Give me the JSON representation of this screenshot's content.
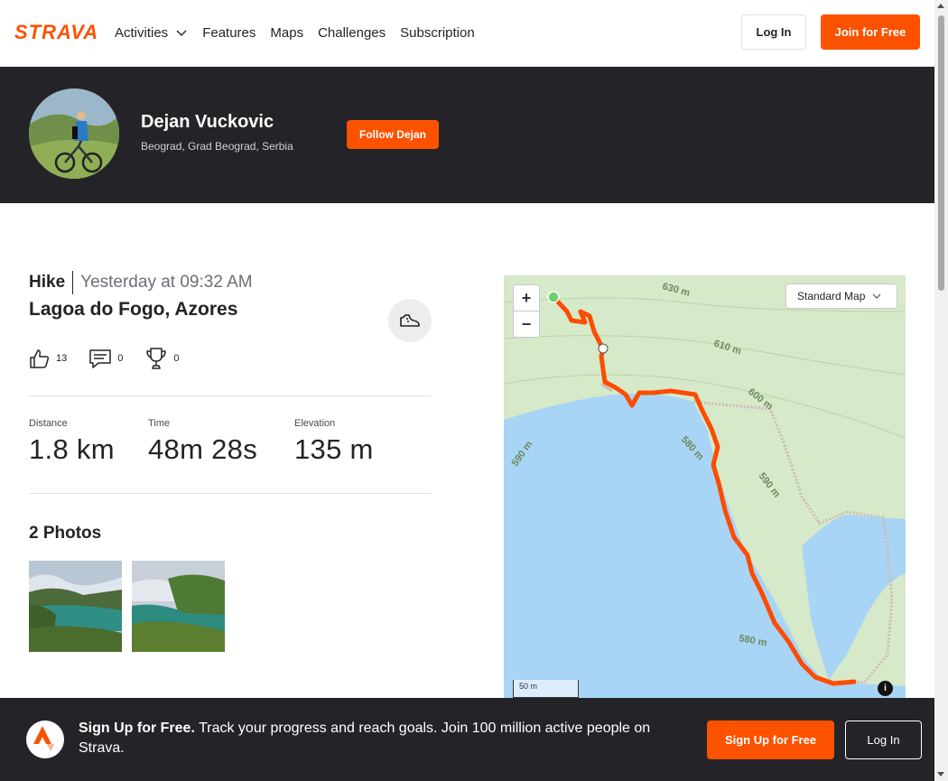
{
  "brand": {
    "logo_text": "STRAVA",
    "accent_color": "#fc5200"
  },
  "nav": {
    "items": [
      {
        "label": "Activities",
        "has_dropdown": true
      },
      {
        "label": "Features"
      },
      {
        "label": "Maps"
      },
      {
        "label": "Challenges"
      },
      {
        "label": "Subscription"
      }
    ],
    "login_label": "Log In",
    "join_label": "Join for Free"
  },
  "athlete": {
    "name": "Dejan Vuckovic",
    "location": "Beograd, Grad Beograd, Serbia",
    "follow_label": "Follow Dejan"
  },
  "activity": {
    "type": "Hike",
    "date": "Yesterday at 09:32 AM",
    "title": "Lagoa do Fogo, Azores",
    "kudos": "13",
    "comments": "0",
    "achievements": "0",
    "stats": [
      {
        "label": "Distance",
        "value": "1.8 km"
      },
      {
        "label": "Time",
        "value": "48m 28s"
      },
      {
        "label": "Elevation",
        "value": "135 m"
      }
    ],
    "photos_title": "2 Photos"
  },
  "map": {
    "style_label": "Standard Map",
    "zoom_in": "+",
    "zoom_out": "−",
    "scale_label": "50 m",
    "info_label": "i",
    "contours": [
      "630 m",
      "610 m",
      "600 m",
      "590 m",
      "580 m",
      "590 m",
      "580 m"
    ]
  },
  "banner": {
    "headline": "Sign Up for Free.",
    "text": "Track your progress and reach goals. Join 100 million active people on Strava.",
    "signup_label": "Sign Up for Free",
    "login_label": "Log In"
  }
}
